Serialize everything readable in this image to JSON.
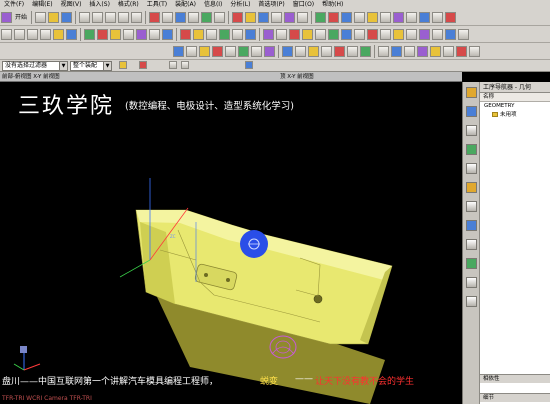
{
  "menu": [
    "文件(F)",
    "编辑(E)",
    "视图(V)",
    "插入(S)",
    "格式(R)",
    "工具(T)",
    "装配(A)",
    "信息(I)",
    "分析(L)",
    "首选项(P)",
    "窗口(O)",
    "帮助(H)"
  ],
  "toolbar": {
    "start_label": "开始",
    "selection_filter": "没有选择过滤器",
    "assembly_filter": "整个装配"
  },
  "views": {
    "left_label": "前部-俯视图 X-Y 前视图",
    "right_label": "顶 X-Y 前视图"
  },
  "overlay": {
    "brand": "三玖学院",
    "subtitle": "(数控编程、电极设计、造型系统化学习)",
    "banner_a": "盘川——中国互联网第一个讲解汽车模具编程工程师，",
    "banner_b": "蜕变",
    "banner_c": "——",
    "banner_d": "让天下没有教不会的学生",
    "status": "TFR-TRI WCRI Camera TFR-TRI"
  },
  "navigator": {
    "title": "工序导航器 - 几何",
    "column": "名称",
    "items": [
      "GEOMETRY",
      "未用项"
    ],
    "footer_1": "相依性",
    "footer_2": "细节"
  },
  "colors": {
    "part": "#e8e870",
    "part_shadow": "#8f8a2c",
    "cursor_blue": "#2a4ee8",
    "banner_red": "#ff3030"
  }
}
